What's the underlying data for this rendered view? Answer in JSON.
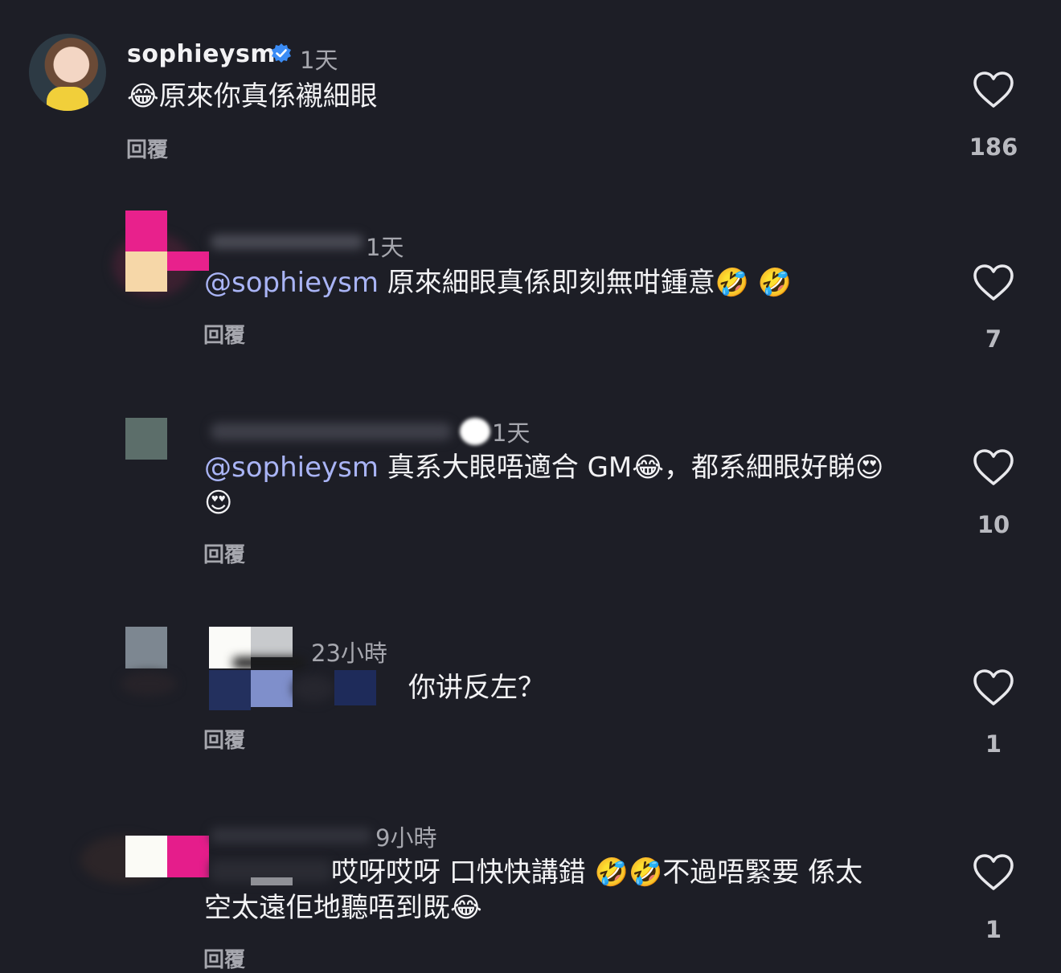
{
  "comments": [
    {
      "username": "sophieysm",
      "time": "1天",
      "text_emoji": "😂",
      "text": "原來你真係襯細眼",
      "reply": "回覆",
      "likes": "186"
    },
    {
      "time": "1天",
      "mention": "@sophieysm",
      "text": "原來細眼真係即刻無咁鍾意",
      "text_emoji": "🤣 🤣",
      "reply": "回覆",
      "likes": "7"
    },
    {
      "time": "1天",
      "mention": "@sophieysm",
      "text_a": "真系大眼唔適合 GM",
      "emoji_a": "😂",
      "text_b": "，都系細眼好睇",
      "emoji_b": "😍",
      "line2_emoji": "😍",
      "reply": "回覆",
      "likes": "10"
    },
    {
      "time": "23小時",
      "text": "你讲反左？",
      "reply": "回覆",
      "likes": "1"
    },
    {
      "time": "9小時",
      "text_a": "哎呀哎呀 口快快講錯",
      "emoji_a": "🤣🤣",
      "text_b": "不過唔緊要 係太",
      "line2": "空太遠佢地聽唔到既",
      "line2_emoji": "😂",
      "reply": "回覆",
      "likes": "1"
    }
  ],
  "colors": {
    "background": "#1d1e26",
    "mention": "#a9b4f5",
    "muted": "#a6a7ae",
    "verified": "#3b8cf5"
  }
}
